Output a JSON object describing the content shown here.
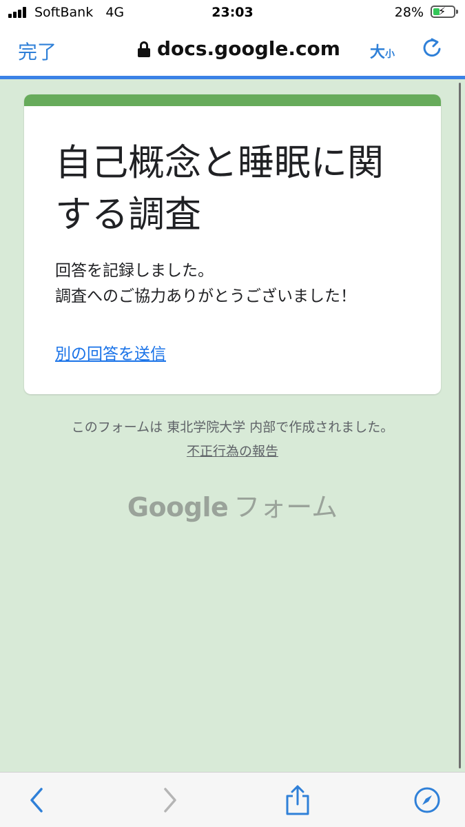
{
  "status": {
    "carrier": "SoftBank",
    "network": "4G",
    "time": "23:03",
    "battery": "28%"
  },
  "browser": {
    "done_label": "完了",
    "url": "docs.google.com",
    "text_size_big": "大",
    "text_size_small": "小"
  },
  "form": {
    "title": "自己概念と睡眠に関する調査",
    "message_line1": "回答を記録しました。",
    "message_line2": "調査へのご協力ありがとうございました！",
    "another_response": "別の回答を送信"
  },
  "footer": {
    "note": "このフォームは 東北学院大学 内部で作成されました。",
    "report": "不正行為の報告",
    "brand_google": "Google",
    "brand_forms": "フォーム"
  },
  "colors": {
    "accent": "#2f80d8",
    "form_header": "#67ab5b",
    "page_bg": "#d8ead7",
    "link": "#1a73e8"
  }
}
